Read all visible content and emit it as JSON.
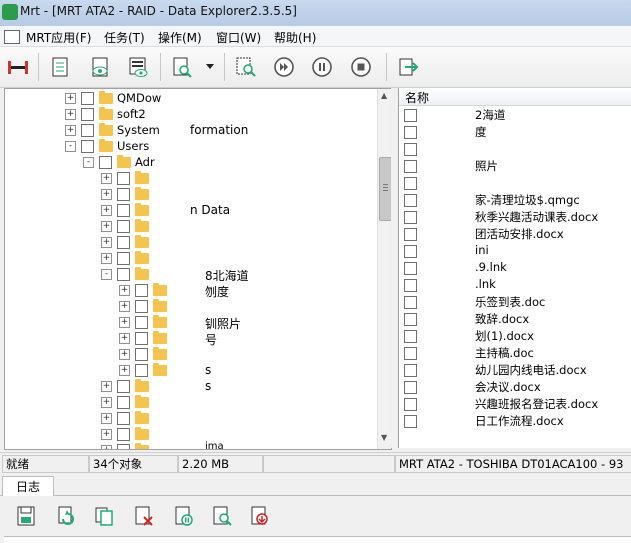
{
  "window": {
    "title": "Mrt - [MRT ATA2 - RAID - Data Explorer2.3.5.5]"
  },
  "menu": [
    "MRT应用(F)",
    "任务(T)",
    "操作(M)",
    "窗口(W)",
    "帮助(H)"
  ],
  "tree": {
    "rows": [
      {
        "label": "QMDow"
      },
      {
        "label": "soft2"
      },
      {
        "label": "System"
      },
      {
        "label": "Users"
      },
      {
        "label": "Adr"
      },
      {
        "label": ""
      },
      {
        "label": ""
      },
      {
        "label": ""
      },
      {
        "label": ""
      },
      {
        "label": ""
      },
      {
        "label": ""
      },
      {
        "label": ""
      },
      {
        "label": ""
      },
      {
        "label": ""
      },
      {
        "label": ""
      },
      {
        "label": ""
      },
      {
        "label": ""
      },
      {
        "label": ""
      },
      {
        "label": ""
      },
      {
        "label": ""
      },
      {
        "label": ""
      },
      {
        "label": ""
      },
      {
        "label": ""
      },
      {
        "label": ""
      }
    ],
    "fragments": [
      "formation",
      "n Data",
      "8北海道",
      "刎度",
      "钏照片",
      "号",
      "s",
      "s",
      "ima"
    ]
  },
  "list": {
    "header": "名称",
    "items": [
      "2海道",
      "度",
      "",
      "照片",
      "",
      "家-清理垃圾$.qmgc",
      "秋季兴趣活动课表.docx",
      "团活动安排.docx",
      "ini",
      ".9.lnk",
      ".lnk",
      "乐签到表.doc",
      "致辞.docx",
      "划(1).docx",
      "主持稿.doc",
      "幼儿园内线电话.docx",
      "会决议.docx",
      "兴趣班报名登记表.docx",
      "日工作流程.docx"
    ]
  },
  "status": {
    "ready": "就绪",
    "count": "34个对象",
    "size": "2.20 MB",
    "empty": "",
    "device": "MRT ATA2 - TOSHIBA DT01ACA100 - 93"
  },
  "log": {
    "tab": "日志"
  },
  "colors": {
    "titlebar": "#bfd1ea",
    "folder": "#f4c44f",
    "accent": "#2d9b4c"
  }
}
